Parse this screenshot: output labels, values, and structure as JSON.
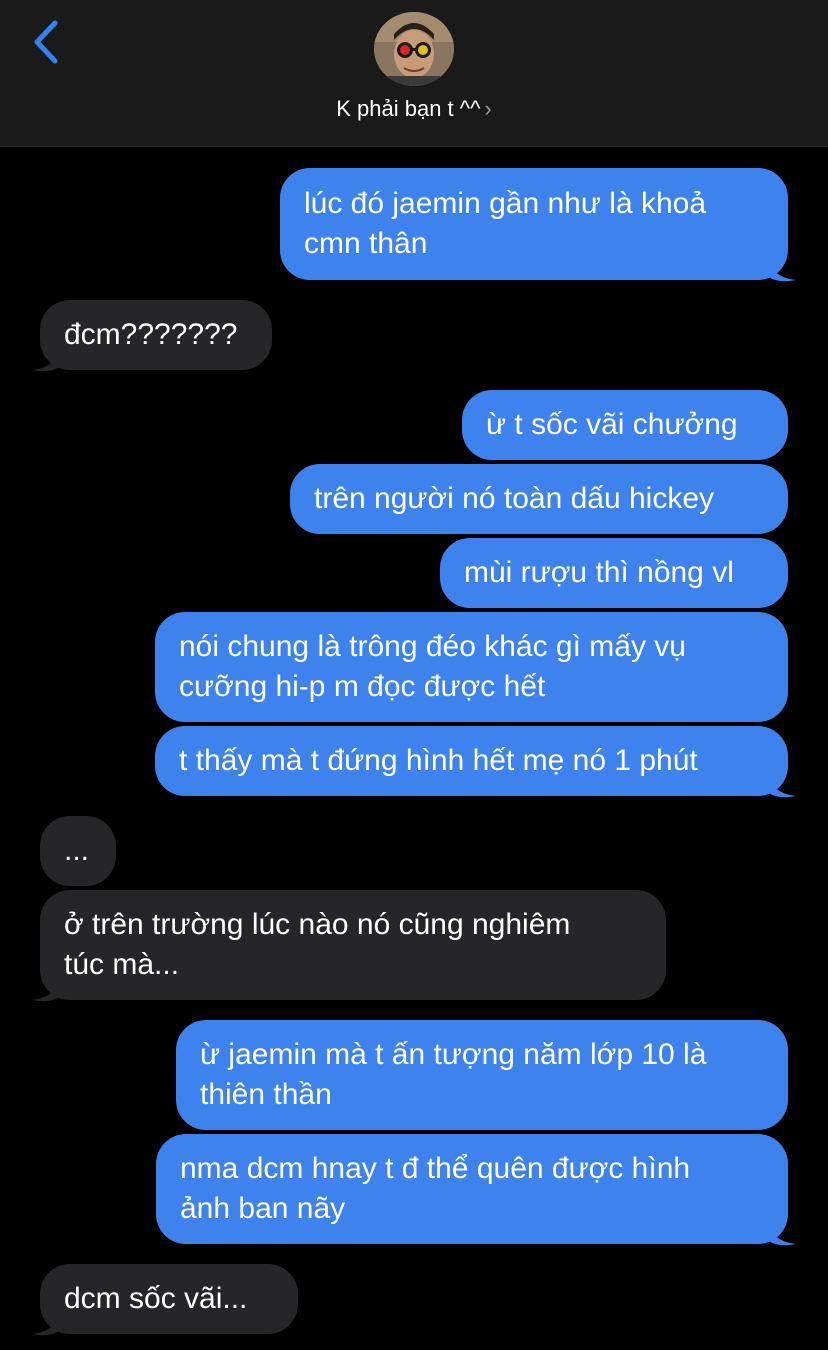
{
  "header": {
    "contact_name": "K phải bạn t ^^",
    "chevron": "›"
  },
  "icons": {
    "back": "back-chevron-icon",
    "avatar": "contact-avatar"
  },
  "colors": {
    "sent_bubble": "#3d82ed",
    "received_bubble": "#262629",
    "accent": "#2f84f2",
    "background": "#000000"
  },
  "messages": [
    {
      "direction": "sent",
      "lines": [
        "lúc đó jaemin gần như là khoả",
        "cmn thân"
      ]
    },
    {
      "direction": "received",
      "lines": [
        "đcm???????"
      ]
    },
    {
      "direction": "sent",
      "lines": [
        "ừ t sốc vãi chưởng"
      ]
    },
    {
      "direction": "sent",
      "lines": [
        "trên người nó toàn dấu hickey"
      ]
    },
    {
      "direction": "sent",
      "lines": [
        "mùi rượu thì nồng vl"
      ]
    },
    {
      "direction": "sent",
      "lines": [
        "nói chung là trông đéo khác gì mấy vụ",
        "cưỡng hi-p m đọc được hết"
      ]
    },
    {
      "direction": "sent",
      "lines": [
        "t thấy mà t đứng hình hết mẹ nó 1 phút"
      ]
    },
    {
      "direction": "received",
      "lines": [
        "..."
      ]
    },
    {
      "direction": "received",
      "lines": [
        "ở trên trường lúc nào nó cũng nghiêm",
        "túc mà..."
      ]
    },
    {
      "direction": "sent",
      "lines": [
        "ừ jaemin mà t ấn tượng năm lớp 10 là",
        "thiên thần"
      ]
    },
    {
      "direction": "sent",
      "lines": [
        "nma dcm hnay t đ thể quên được hình",
        "ảnh ban nãy"
      ]
    },
    {
      "direction": "received",
      "lines": [
        "dcm sốc vãi..."
      ]
    }
  ]
}
